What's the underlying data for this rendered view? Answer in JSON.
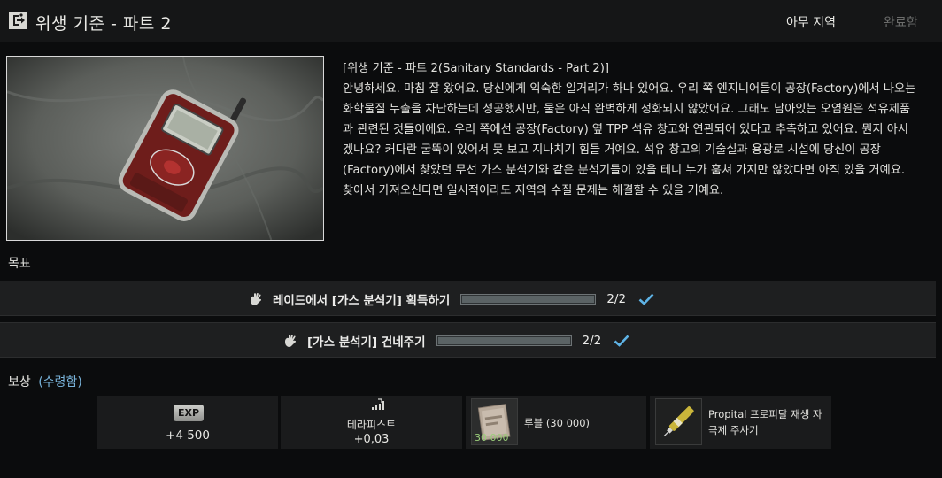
{
  "header": {
    "title": "위생 기준 - 파트 2",
    "icon": "quest-exit-icon",
    "location": "아무 지역",
    "status": "완료함"
  },
  "description": {
    "title": "[위생 기준 - 파트 2(Sanitary Standards - Part 2)]",
    "body": "안녕하세요. 마침 잘 왔어요. 당신에게 익숙한 일거리가 하나 있어요. 우리 쪽 엔지니어들이 공장(Factory)에서 나오는 화학물질 누출을 차단하는데 성공했지만, 물은 아직 완벽하게 정화되지 않았어요. 그래도 남아있는 오염원은 석유제품과 관련된 것들이에요. 우리 쪽에선 공장(Factory) 옆 TPP 석유 창고와 연관되어 있다고 추측하고 있어요. 뭔지 아시겠나요? 커다란 굴뚝이 있어서 못 보고 지나치기 힘들 거예요. 석유 창고의 기술실과 용광로 시설에 당신이 공장(Factory)에서 찾았던 무선 가스 분석기와 같은 분석기들이 있을 테니 누가 훔쳐 가지만 않았다면 아직 있을 거예요. 찾아서 가져오신다면 일시적이라도 지역의 수질 문제는 해결할 수 있을 거예요."
  },
  "objectives": {
    "label": "목표",
    "items": [
      {
        "icon": "hand-icon",
        "text": "레이드에서 [가스 분석기] 획득하기",
        "count": "2/2",
        "progress": 1.0,
        "completed": true
      },
      {
        "icon": "hand-icon",
        "text": "[가스 분석기] 건네주기",
        "count": "2/2",
        "progress": 1.0,
        "completed": true
      }
    ]
  },
  "rewards": {
    "label": "보상",
    "received": "(수령함)",
    "exp": {
      "badge": "EXP",
      "value": "+4 500"
    },
    "reputation": {
      "icon": "reputation-icon",
      "trader": "테라피스트",
      "value": "+0,03"
    },
    "items": [
      {
        "icon": "roubles-icon",
        "quantity": "30 000",
        "name": "루블 (30 000)"
      },
      {
        "icon": "propital-syringe-icon",
        "quantity": "",
        "name": "Propital 프로피탈 재생 자극제 주사기"
      }
    ]
  },
  "colors": {
    "accent_blue": "#79b3da",
    "check_blue": "#5eb3e6",
    "money_green": "#9bcf7a",
    "row_background": "#1e1f20"
  }
}
